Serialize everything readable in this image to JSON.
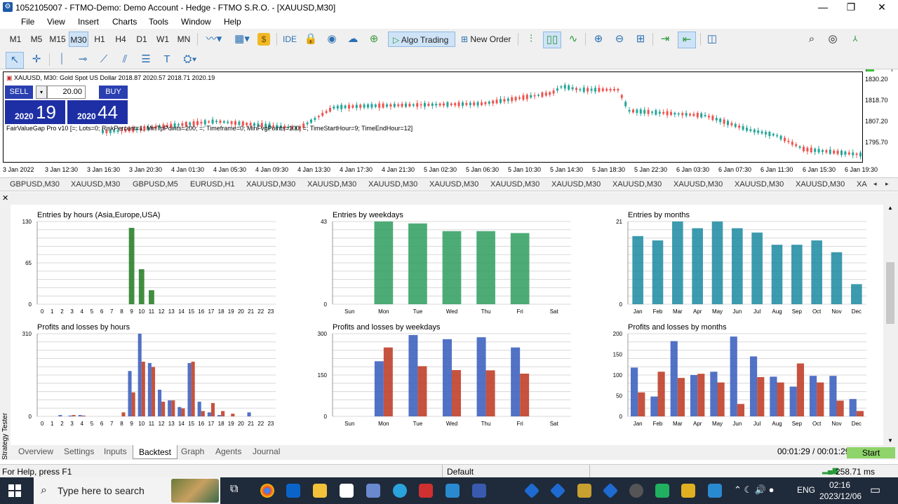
{
  "window": {
    "title": "1052105007 - FTMO-Demo: Demo Account - Hedge - FTMO S.R.O. - [XAUUSD,M30]",
    "min": "—",
    "max": "❐",
    "close": "✕"
  },
  "menu": [
    "File",
    "View",
    "Insert",
    "Charts",
    "Tools",
    "Window",
    "Help"
  ],
  "toolbar": {
    "timeframes": [
      "M1",
      "M5",
      "M15",
      "M30",
      "H1",
      "H4",
      "D1",
      "W1",
      "MN"
    ],
    "selected_timeframe": "M30",
    "ide_label": "IDE",
    "algo_trading_label": "Algo Trading",
    "new_order_label": "New Order"
  },
  "chart": {
    "header": "XAUUSD, M30:  Gold Spot US Dollar  2018.87 2020.57 2018.71 2020.19",
    "indicator": "FairValueGap Pro v10 [=; Lots=0; RiskPercent=1; MinTpPoints=200; =; Timeframe=0; MinFvgPoints=100; =; TimeStartHour=9; TimeEndHour=12]",
    "sell_label": "SELL",
    "buy_label": "BUY",
    "lot": "20.00",
    "sell_price_small": "2020",
    "sell_price_big": "19",
    "buy_price_small": "2020",
    "buy_price_big": "44",
    "price_ticks": [
      "1830.20",
      "1818.70",
      "1807.20",
      "1795.70"
    ],
    "time_ticks": [
      "3 Jan 2022",
      "3 Jan 12:30",
      "3 Jan 16:30",
      "3 Jan 20:30",
      "4 Jan 01:30",
      "4 Jan 05:30",
      "4 Jan 09:30",
      "4 Jan 13:30",
      "4 Jan 17:30",
      "4 Jan 21:30",
      "5 Jan 02:30",
      "5 Jan 06:30",
      "5 Jan 10:30",
      "5 Jan 14:30",
      "5 Jan 18:30",
      "5 Jan 22:30",
      "6 Jan 03:30",
      "6 Jan 07:30",
      "6 Jan 11:30",
      "6 Jan 15:30",
      "6 Jan 19:30"
    ],
    "colors": {
      "up": "#26a69a",
      "down": "#ef5350"
    }
  },
  "symbol_tabs": [
    "GBPUSD,M30",
    "XAUUSD,M30",
    "GBPUSD,M5",
    "EURUSD,H1",
    "XAUUSD,M30",
    "XAUUSD,M30",
    "XAUUSD,M30",
    "XAUUSD,M30",
    "XAUUSD,M30",
    "XAUUSD,M30",
    "XAUUSD,M30",
    "XAUUSD,M30",
    "XAUUSD,M30",
    "XAUUSD,M30",
    "XA"
  ],
  "tester": {
    "vertical_label": "Strategy Tester",
    "tabs": [
      "Overview",
      "Settings",
      "Inputs",
      "Backtest",
      "Graph",
      "Agents",
      "Journal"
    ],
    "active_tab": "Backtest",
    "time": "00:01:29 / 00:01:29",
    "start_label": "Start"
  },
  "chart_data": [
    {
      "type": "bar",
      "title": "Entries by hours (Asia,Europe,USA)",
      "categories": [
        "0",
        "1",
        "2",
        "3",
        "4",
        "5",
        "6",
        "7",
        "8",
        "9",
        "10",
        "11",
        "12",
        "13",
        "14",
        "15",
        "16",
        "17",
        "18",
        "19",
        "20",
        "21",
        "22",
        "23"
      ],
      "ytick_labels": [
        "130",
        "65",
        "0"
      ],
      "ylim": [
        0,
        130
      ],
      "values": [
        0,
        0,
        0,
        0,
        0,
        0,
        0,
        0,
        0,
        120,
        55,
        22,
        0,
        0,
        0,
        0,
        0,
        0,
        0,
        0,
        0,
        0,
        0,
        0
      ],
      "colors": [
        "#1e7a1e"
      ]
    },
    {
      "type": "bar",
      "title": "Entries by weekdays",
      "categories": [
        "Sun",
        "Mon",
        "Tue",
        "Wed",
        "Thu",
        "Fri",
        "Sat"
      ],
      "ytick_labels": [
        "43",
        "0"
      ],
      "ylim": [
        0,
        43
      ],
      "values": [
        0,
        43,
        42,
        38,
        38,
        37,
        0
      ],
      "colors": [
        "#2e9e5e"
      ]
    },
    {
      "type": "bar",
      "title": "Entries by months",
      "categories": [
        "Jan",
        "Feb",
        "Mar",
        "Apr",
        "May",
        "Jun",
        "Jul",
        "Aug",
        "Sep",
        "Oct",
        "Nov",
        "Dec"
      ],
      "ytick_labels": [
        "21",
        "0"
      ],
      "ylim": [
        0,
        21
      ],
      "values": [
        17.3,
        16.2,
        21,
        19.3,
        21,
        19.3,
        18.2,
        15.1,
        15.1,
        16.2,
        13.2,
        5.1
      ],
      "colors": [
        "#1a8aa0"
      ]
    },
    {
      "type": "bar",
      "title": "Profits and losses by hours",
      "categories": [
        "0",
        "1",
        "2",
        "3",
        "4",
        "5",
        "6",
        "7",
        "8",
        "9",
        "10",
        "11",
        "12",
        "13",
        "14",
        "15",
        "16",
        "17",
        "18",
        "19",
        "20",
        "21",
        "22",
        "23"
      ],
      "ytick_labels": [
        "310",
        "0"
      ],
      "ylim": [
        0,
        310
      ],
      "series": [
        {
          "values": [
            0,
            0,
            5,
            3,
            5,
            0,
            0,
            0,
            0,
            170,
            310,
            200,
            100,
            60,
            35,
            200,
            55,
            15,
            5,
            0,
            0,
            15,
            0,
            0
          ],
          "color": "#3f63c0"
        },
        {
          "values": [
            0,
            0,
            0,
            5,
            3,
            0,
            0,
            0,
            15,
            90,
            205,
            185,
            55,
            60,
            30,
            205,
            20,
            50,
            20,
            10,
            0,
            0,
            0,
            0
          ],
          "color": "#c0402a"
        }
      ]
    },
    {
      "type": "bar",
      "title": "Profits and losses by weekdays",
      "categories": [
        "Sun",
        "Mon",
        "Tue",
        "Wed",
        "Thu",
        "Fri",
        "Sat"
      ],
      "ytick_labels": [
        "300",
        "150",
        "0"
      ],
      "ylim": [
        0,
        300
      ],
      "series": [
        {
          "values": [
            0,
            200,
            295,
            280,
            287,
            250,
            0
          ],
          "color": "#3f63c0"
        },
        {
          "values": [
            0,
            250,
            182,
            168,
            167,
            155,
            0
          ],
          "color": "#c0402a"
        }
      ]
    },
    {
      "type": "bar",
      "title": "Profits and losses by months",
      "categories": [
        "Jan",
        "Feb",
        "Mar",
        "Apr",
        "May",
        "Jun",
        "Jul",
        "Aug",
        "Sep",
        "Oct",
        "Nov",
        "Dec"
      ],
      "ytick_labels": [
        "200",
        "150",
        "100",
        "50",
        "0"
      ],
      "ylim": [
        0,
        200
      ],
      "series": [
        {
          "values": [
            118,
            48,
            182,
            100,
            108,
            193,
            145,
            96,
            72,
            98,
            98,
            42
          ],
          "color": "#3f63c0"
        },
        {
          "values": [
            58,
            108,
            93,
            103,
            82,
            30,
            95,
            82,
            128,
            82,
            38,
            13
          ],
          "color": "#c0402a"
        }
      ]
    }
  ],
  "status": {
    "help": "For Help, press F1",
    "profile": "Default",
    "ping": "258.71 ms"
  },
  "taskbar": {
    "search": "Type here to search",
    "lang": "ENG",
    "time": "02:16",
    "date": "2023/12/06"
  }
}
